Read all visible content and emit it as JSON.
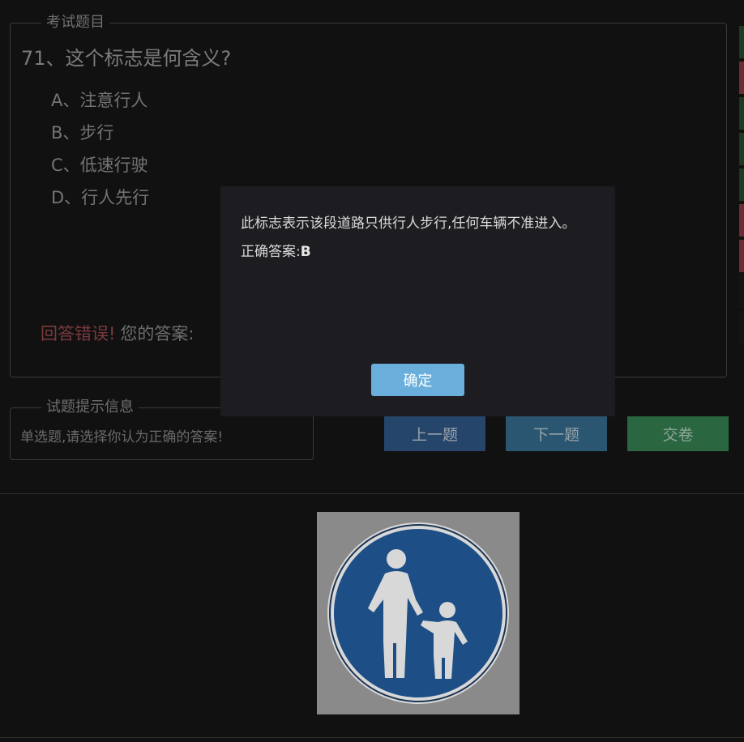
{
  "question_panel": {
    "legend": "考试题目",
    "question": "71、这个标志是何含义?",
    "options": [
      {
        "label": "A、注意行人"
      },
      {
        "label": "B、步行"
      },
      {
        "label": "C、低速行驶"
      },
      {
        "label": "D、行人先行"
      }
    ],
    "result_label": "回答错误!",
    "your_answer_label": "您的答案:"
  },
  "hint_panel": {
    "legend": "试题提示信息",
    "text": "单选题,请选择你认为正确的答案!"
  },
  "nav": {
    "prev_label": "上一题",
    "next_label": "下一题",
    "submit_label": "交卷"
  },
  "answer_card_colors": [
    "#1d3a22",
    "#6b2c36",
    "#1d3a22",
    "#1d3a22",
    "#1d3a22",
    "#6b2c36",
    "#6b2c36",
    "#141414",
    "#141414"
  ],
  "modal": {
    "explanation": "此标志表示该段道路只供行人步行,任何车辆不准进入。",
    "correct_label": "正确答案:",
    "correct_value": "B",
    "ok_label": "确定"
  },
  "sign_image": {
    "icon": "pedestrian-only-sign-icon",
    "colors": {
      "outer": "#d8d8d8",
      "blue": "#1d4f86",
      "figure": "#d8d8d8"
    }
  }
}
